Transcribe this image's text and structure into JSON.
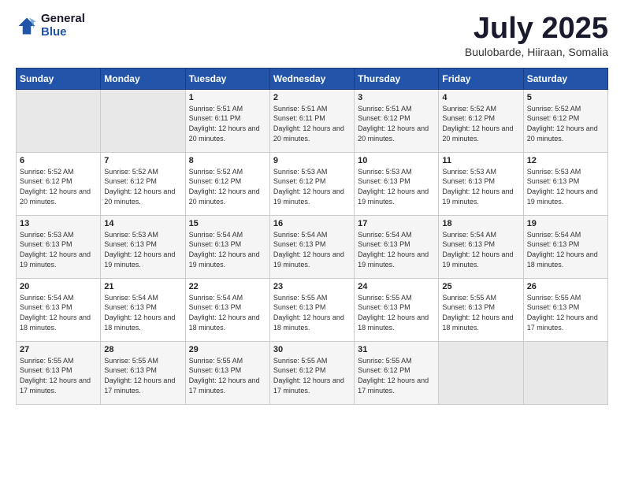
{
  "header": {
    "logo_general": "General",
    "logo_blue": "Blue",
    "month": "July 2025",
    "location": "Buulobarde, Hiiraan, Somalia"
  },
  "days_of_week": [
    "Sunday",
    "Monday",
    "Tuesday",
    "Wednesday",
    "Thursday",
    "Friday",
    "Saturday"
  ],
  "weeks": [
    [
      {
        "day": "",
        "info": ""
      },
      {
        "day": "",
        "info": ""
      },
      {
        "day": "1",
        "info": "Sunrise: 5:51 AM\nSunset: 6:11 PM\nDaylight: 12 hours and 20 minutes."
      },
      {
        "day": "2",
        "info": "Sunrise: 5:51 AM\nSunset: 6:11 PM\nDaylight: 12 hours and 20 minutes."
      },
      {
        "day": "3",
        "info": "Sunrise: 5:51 AM\nSunset: 6:12 PM\nDaylight: 12 hours and 20 minutes."
      },
      {
        "day": "4",
        "info": "Sunrise: 5:52 AM\nSunset: 6:12 PM\nDaylight: 12 hours and 20 minutes."
      },
      {
        "day": "5",
        "info": "Sunrise: 5:52 AM\nSunset: 6:12 PM\nDaylight: 12 hours and 20 minutes."
      }
    ],
    [
      {
        "day": "6",
        "info": "Sunrise: 5:52 AM\nSunset: 6:12 PM\nDaylight: 12 hours and 20 minutes."
      },
      {
        "day": "7",
        "info": "Sunrise: 5:52 AM\nSunset: 6:12 PM\nDaylight: 12 hours and 20 minutes."
      },
      {
        "day": "8",
        "info": "Sunrise: 5:52 AM\nSunset: 6:12 PM\nDaylight: 12 hours and 20 minutes."
      },
      {
        "day": "9",
        "info": "Sunrise: 5:53 AM\nSunset: 6:12 PM\nDaylight: 12 hours and 19 minutes."
      },
      {
        "day": "10",
        "info": "Sunrise: 5:53 AM\nSunset: 6:13 PM\nDaylight: 12 hours and 19 minutes."
      },
      {
        "day": "11",
        "info": "Sunrise: 5:53 AM\nSunset: 6:13 PM\nDaylight: 12 hours and 19 minutes."
      },
      {
        "day": "12",
        "info": "Sunrise: 5:53 AM\nSunset: 6:13 PM\nDaylight: 12 hours and 19 minutes."
      }
    ],
    [
      {
        "day": "13",
        "info": "Sunrise: 5:53 AM\nSunset: 6:13 PM\nDaylight: 12 hours and 19 minutes."
      },
      {
        "day": "14",
        "info": "Sunrise: 5:53 AM\nSunset: 6:13 PM\nDaylight: 12 hours and 19 minutes."
      },
      {
        "day": "15",
        "info": "Sunrise: 5:54 AM\nSunset: 6:13 PM\nDaylight: 12 hours and 19 minutes."
      },
      {
        "day": "16",
        "info": "Sunrise: 5:54 AM\nSunset: 6:13 PM\nDaylight: 12 hours and 19 minutes."
      },
      {
        "day": "17",
        "info": "Sunrise: 5:54 AM\nSunset: 6:13 PM\nDaylight: 12 hours and 19 minutes."
      },
      {
        "day": "18",
        "info": "Sunrise: 5:54 AM\nSunset: 6:13 PM\nDaylight: 12 hours and 19 minutes."
      },
      {
        "day": "19",
        "info": "Sunrise: 5:54 AM\nSunset: 6:13 PM\nDaylight: 12 hours and 18 minutes."
      }
    ],
    [
      {
        "day": "20",
        "info": "Sunrise: 5:54 AM\nSunset: 6:13 PM\nDaylight: 12 hours and 18 minutes."
      },
      {
        "day": "21",
        "info": "Sunrise: 5:54 AM\nSunset: 6:13 PM\nDaylight: 12 hours and 18 minutes."
      },
      {
        "day": "22",
        "info": "Sunrise: 5:54 AM\nSunset: 6:13 PM\nDaylight: 12 hours and 18 minutes."
      },
      {
        "day": "23",
        "info": "Sunrise: 5:55 AM\nSunset: 6:13 PM\nDaylight: 12 hours and 18 minutes."
      },
      {
        "day": "24",
        "info": "Sunrise: 5:55 AM\nSunset: 6:13 PM\nDaylight: 12 hours and 18 minutes."
      },
      {
        "day": "25",
        "info": "Sunrise: 5:55 AM\nSunset: 6:13 PM\nDaylight: 12 hours and 18 minutes."
      },
      {
        "day": "26",
        "info": "Sunrise: 5:55 AM\nSunset: 6:13 PM\nDaylight: 12 hours and 17 minutes."
      }
    ],
    [
      {
        "day": "27",
        "info": "Sunrise: 5:55 AM\nSunset: 6:13 PM\nDaylight: 12 hours and 17 minutes."
      },
      {
        "day": "28",
        "info": "Sunrise: 5:55 AM\nSunset: 6:13 PM\nDaylight: 12 hours and 17 minutes."
      },
      {
        "day": "29",
        "info": "Sunrise: 5:55 AM\nSunset: 6:13 PM\nDaylight: 12 hours and 17 minutes."
      },
      {
        "day": "30",
        "info": "Sunrise: 5:55 AM\nSunset: 6:12 PM\nDaylight: 12 hours and 17 minutes."
      },
      {
        "day": "31",
        "info": "Sunrise: 5:55 AM\nSunset: 6:12 PM\nDaylight: 12 hours and 17 minutes."
      },
      {
        "day": "",
        "info": ""
      },
      {
        "day": "",
        "info": ""
      }
    ]
  ]
}
